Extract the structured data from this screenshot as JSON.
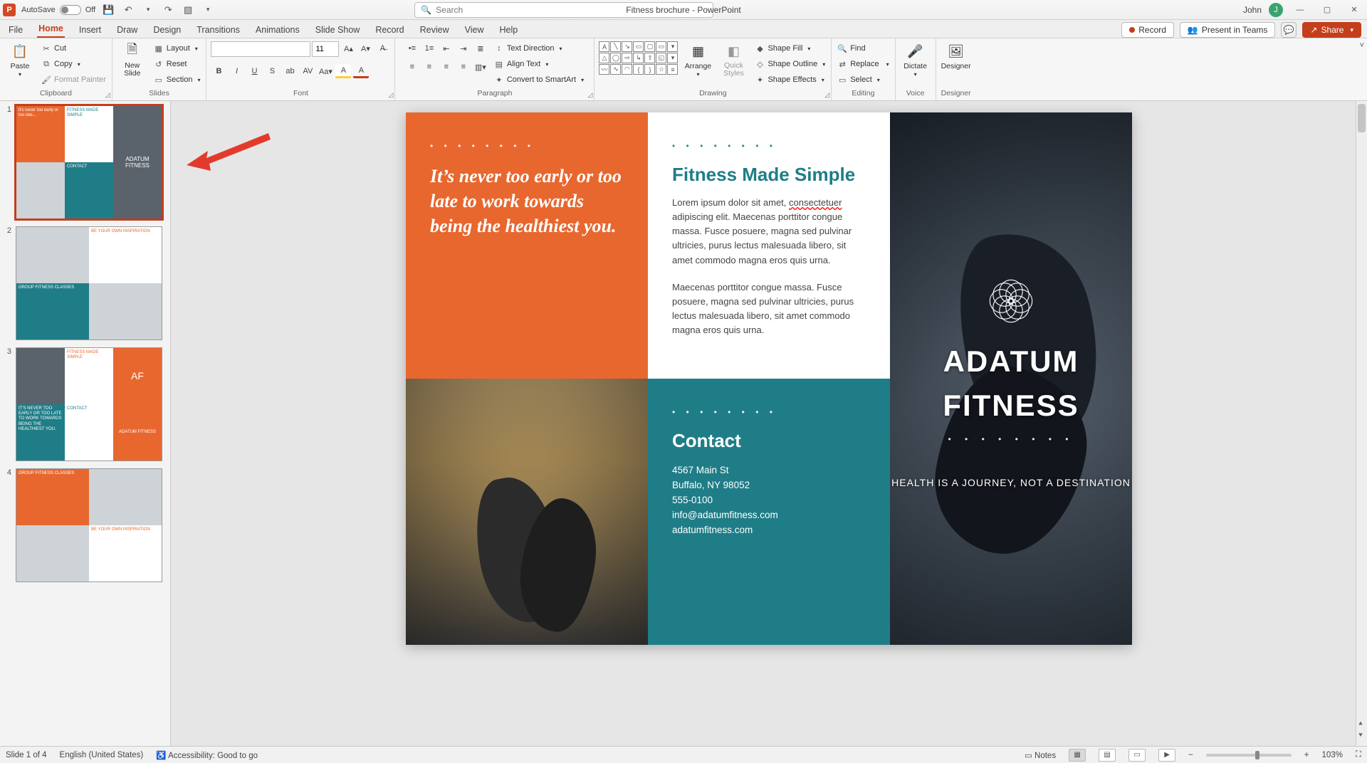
{
  "titlebar": {
    "autosave_label": "AutoSave",
    "autosave_state": "Off",
    "doc_title": "Fitness brochure  -  PowerPoint",
    "search_placeholder": "Search",
    "user_name": "John",
    "user_initial": "J"
  },
  "qat": {
    "save_tip": "Save",
    "undo_tip": "Undo",
    "redo_tip": "Redo",
    "present_tip": "From Beginning",
    "customize_tip": "Customize Quick Access Toolbar"
  },
  "menu": {
    "items": [
      "File",
      "Home",
      "Insert",
      "Draw",
      "Design",
      "Transitions",
      "Animations",
      "Slide Show",
      "Record",
      "Review",
      "View",
      "Help"
    ],
    "active_index": 1,
    "record_label": "Record",
    "present_teams_label": "Present in Teams",
    "share_label": "Share"
  },
  "ribbon": {
    "clipboard": {
      "label": "Clipboard",
      "paste": "Paste",
      "cut": "Cut",
      "copy": "Copy",
      "format_painter": "Format Painter"
    },
    "slides": {
      "label": "Slides",
      "new_slide": "New\nSlide",
      "layout": "Layout",
      "reset": "Reset",
      "section": "Section"
    },
    "font": {
      "label": "Font",
      "size_value": "11"
    },
    "paragraph": {
      "label": "Paragraph",
      "text_direction": "Text Direction",
      "align_text": "Align Text",
      "convert_smartart": "Convert to SmartArt"
    },
    "drawing": {
      "label": "Drawing",
      "arrange": "Arrange",
      "quick_styles": "Quick\nStyles",
      "shape_fill": "Shape Fill",
      "shape_outline": "Shape Outline",
      "shape_effects": "Shape Effects"
    },
    "editing": {
      "label": "Editing",
      "find": "Find",
      "replace": "Replace",
      "select": "Select"
    },
    "voice": {
      "label": "Voice",
      "dictate": "Dictate"
    },
    "designer": {
      "label": "Designer",
      "designer": "Designer"
    }
  },
  "thumbnails": {
    "labels": {
      "fitness_simple": "FITNESS MADE SIMPLE",
      "contact": "CONTACT",
      "brand": "ADATUM\nFITNESS",
      "orange_quote": "IT'S NEVER TOO EARLY OR TOO LATE TO WORK TOWARDS BEING THE HEALTHIEST YOU.",
      "inspiration": "BE YOUR OWN INSPIRATION",
      "group_classes": "GROUP FITNESS CLASSES",
      "af": "AF"
    }
  },
  "slide1": {
    "dots": "• • • • • • • •",
    "orange_quote": "It’s never too early or too late to work towards being the healthiest you.",
    "section_title": "Fitness Made Simple",
    "body1_pre": "Lorem ipsum dolor sit amet, ",
    "body1_err": "consectetuer",
    "body1_post": " adipiscing elit. Maecenas porttitor congue massa. Fusce posuere, magna sed pulvinar ultricies, purus lectus malesuada libero, sit amet commodo magna eros quis urna.",
    "body2": "Maecenas porttitor congue massa. Fusce posuere, magna sed pulvinar ultricies, purus lectus malesuada libero, sit amet commodo magna eros quis urna.",
    "contact_title": "Contact",
    "contact": {
      "addr1": "4567 Main St",
      "addr2": "Buffalo, NY 98052",
      "phone": "555-0100",
      "email": "info@adatumfitness.com",
      "site": "adatumfitness.com"
    },
    "brand_line1": "ADATUM",
    "brand_line2": "FITNESS",
    "tagline": "HEALTH IS A JOURNEY, NOT A DESTINATION"
  },
  "status": {
    "slide_counter": "Slide 1 of 4",
    "language": "English (United States)",
    "accessibility": "Accessibility: Good to go",
    "notes": "Notes",
    "zoom_pct": "103%"
  }
}
